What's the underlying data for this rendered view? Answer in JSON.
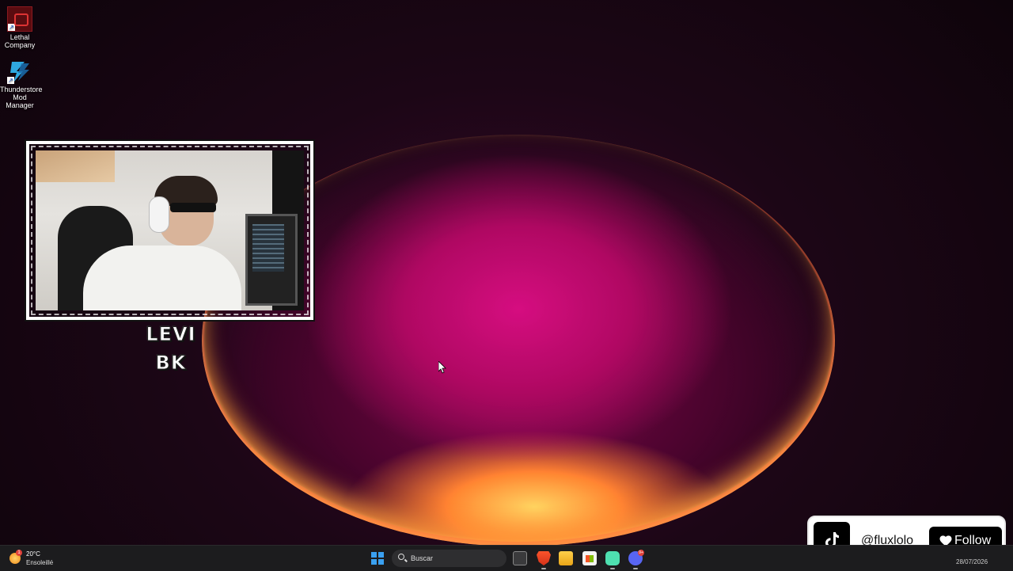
{
  "desktop": {
    "icons": [
      {
        "label_line1": "Lethal",
        "label_line2": "Company",
        "icon": "lethal-company-icon"
      },
      {
        "label_line1": "Thunderstore",
        "label_line2": "Mod",
        "label_line3": "Manager",
        "icon": "thunderstore-icon"
      }
    ]
  },
  "webcam": {
    "name_tag": "LEVI BK"
  },
  "tiktok_widget": {
    "handle": "@fluxlolo",
    "follow_label": "Follow",
    "icon": "tiktok-icon",
    "accent": "#000000"
  },
  "taskbar": {
    "weather": {
      "temp": "20°C",
      "desc": "Ensoleillé",
      "badge": "1",
      "icon": "sun-icon"
    },
    "search_placeholder": "Buscar",
    "apps": [
      {
        "name": "task-view-icon"
      },
      {
        "name": "brave-browser-icon"
      },
      {
        "name": "file-explorer-icon"
      },
      {
        "name": "microsoft-store-icon"
      },
      {
        "name": "game-app-icon"
      },
      {
        "name": "discord-icon",
        "badge": "9+"
      }
    ],
    "date": "28/07/2026"
  },
  "colors": {
    "taskbar_bg": "#1c1c1e",
    "start_blue": "#3aa0f0",
    "wallpaper_magenta": "#c8127a"
  }
}
